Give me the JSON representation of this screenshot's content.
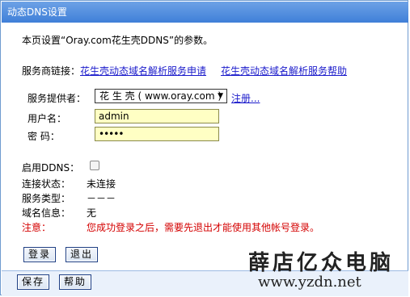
{
  "title": "动态DNS设置",
  "intro": "本页设置“Oray.com花生壳DDNS”的参数。",
  "links": {
    "label": "服务商链接：",
    "apply": "花生壳动态域名解析服务申请",
    "help": "花生壳动态域名解析服务帮助"
  },
  "provider": {
    "label": "服务提供者：",
    "selected": "花 生 壳 ( www.oray.com )",
    "register": "注册..."
  },
  "username": {
    "label": "用户名：",
    "value": "admin"
  },
  "password": {
    "label": "密  码：",
    "value": "•••••"
  },
  "enable_ddns": {
    "label": "启用DDNS：",
    "checked": false
  },
  "status": {
    "conn_label": "连接状态：",
    "conn_value": "未连接",
    "type_label": "服务类型：",
    "type_value": "－－－",
    "domain_label": "域名信息：",
    "domain_value": "无",
    "note_label": "注意：",
    "note_value": "您成功登录之后，需要先退出才能使用其他帐号登录。"
  },
  "buttons": {
    "login": "登录",
    "logout": "退出",
    "save": "保存",
    "help": "帮助"
  },
  "watermark": {
    "brand": "薛店亿众电脑",
    "url": "www.yzdn.net"
  },
  "colors": {
    "title_bar": "#4a87dc",
    "note_red": "#d40000",
    "link_blue": "#1a1acb",
    "input_bg": "#ffffc4"
  }
}
